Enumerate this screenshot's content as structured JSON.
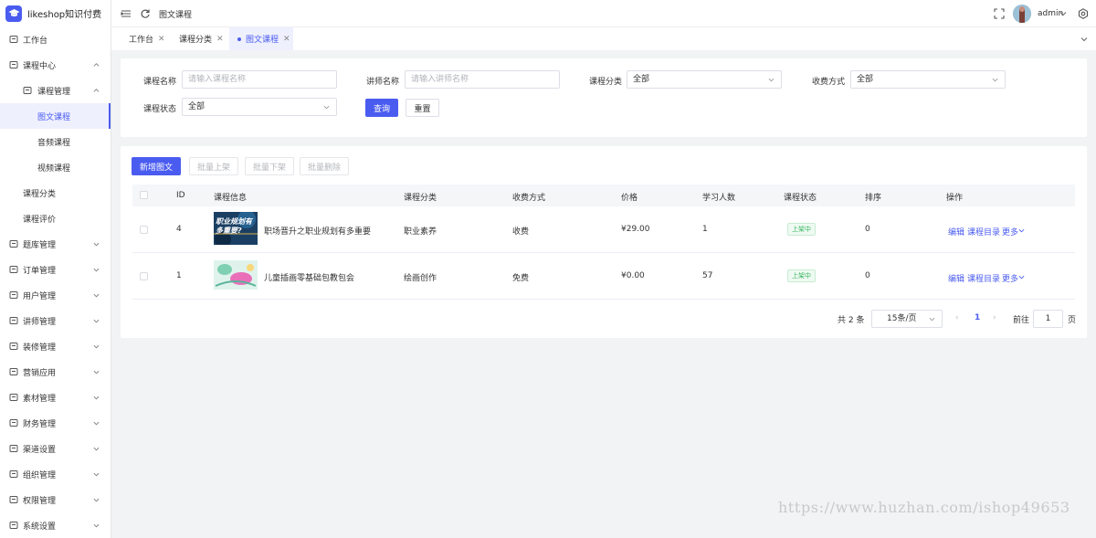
{
  "brand": {
    "name": "likeshop知识付费",
    "color": "#4a5cf0",
    "logo_icon": "graduation-cap-icon"
  },
  "sidebar": {
    "items": [
      {
        "label": "工作台",
        "icon": "monitor-icon",
        "expand": false
      },
      {
        "label": "课程中心",
        "icon": "book-icon",
        "expand": true,
        "expanded": true
      },
      {
        "label": "课程管理",
        "icon": "settings-circle-icon",
        "expand": true,
        "expanded": true
      },
      {
        "label": "图文课程",
        "active": true
      },
      {
        "label": "音频课程"
      },
      {
        "label": "视频课程"
      },
      {
        "label": "课程分类"
      },
      {
        "label": "课程评价"
      },
      {
        "label": "题库管理",
        "icon": "question-bank-icon",
        "expand": true
      },
      {
        "label": "订单管理",
        "icon": "order-icon",
        "expand": true
      },
      {
        "label": "用户管理",
        "icon": "user-icon",
        "expand": true
      },
      {
        "label": "讲师管理",
        "icon": "teacher-icon",
        "expand": true
      },
      {
        "label": "装修管理",
        "icon": "decor-icon",
        "expand": true
      },
      {
        "label": "营销应用",
        "icon": "marketing-icon",
        "expand": true
      },
      {
        "label": "素材管理",
        "icon": "image-icon",
        "expand": true
      },
      {
        "label": "财务管理",
        "icon": "finance-icon",
        "expand": true
      },
      {
        "label": "渠道设置",
        "icon": "channel-icon",
        "expand": true
      },
      {
        "label": "组织管理",
        "icon": "org-icon",
        "expand": true
      },
      {
        "label": "权限管理",
        "icon": "permission-icon",
        "expand": true
      },
      {
        "label": "系统设置",
        "icon": "gear-icon",
        "expand": true
      }
    ]
  },
  "header": {
    "breadcrumb": "图文课程",
    "user_name": "admin"
  },
  "tabs": [
    {
      "label": "工作台",
      "active": false
    },
    {
      "label": "课程分类",
      "active": false
    },
    {
      "label": "图文课程",
      "active": true
    }
  ],
  "filters": {
    "course_name_label": "课程名称",
    "course_name_placeholder": "请输入课程名称",
    "teacher_name_label": "讲师名称",
    "teacher_name_placeholder": "请输入讲师名称",
    "category_label": "课程分类",
    "category_value": "全部",
    "fee_label": "收费方式",
    "fee_value": "全部",
    "status_label": "课程状态",
    "status_value": "全部",
    "query_button": "查询",
    "reset_button": "重置"
  },
  "toolbar": {
    "add_button": "新增图文",
    "batch_on_button": "批量上架",
    "batch_off_button": "批量下架",
    "batch_delete_button": "批量删除"
  },
  "table": {
    "columns": [
      "ID",
      "课程信息",
      "课程分类",
      "收费方式",
      "价格",
      "学习人数",
      "课程状态",
      "排序",
      "操作"
    ],
    "rows": [
      {
        "id": "4",
        "title": "职场晋升之职业规划有多重要",
        "thumb_text": "职业规划有多重要?",
        "category": "职业素养",
        "fee": "收费",
        "price": "¥29.00",
        "learners": "1",
        "status": "上架中",
        "sort": "0",
        "actions": [
          "编辑",
          "课程目录",
          "更多"
        ]
      },
      {
        "id": "1",
        "title": "儿童插画零基础包教包会",
        "category": "绘画创作",
        "fee": "免费",
        "price": "¥0.00",
        "learners": "57",
        "status": "上架中",
        "sort": "0",
        "actions": [
          "编辑",
          "课程目录",
          "更多"
        ]
      }
    ]
  },
  "pagination": {
    "total_text": "共 2 条",
    "page_size": "15条/页",
    "current_page": "1",
    "goto_label": "前往",
    "goto_value": "1",
    "page_suffix": "页"
  },
  "watermark": "https://www.huzhan.com/ishop49653"
}
